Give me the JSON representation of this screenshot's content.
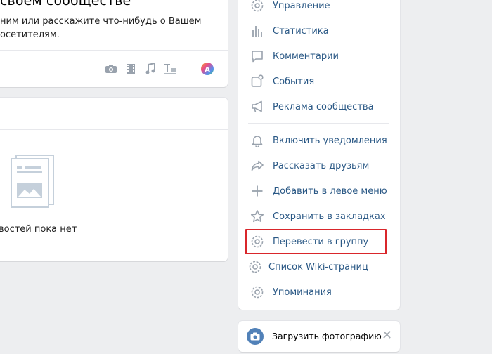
{
  "post_card": {
    "title": "своем сообществе",
    "description_line1": "ним или расскажите что-нибудь о Вашем",
    "description_line2": "осетителям.",
    "attach_icons": [
      "camera-icon",
      "video-icon",
      "music-icon",
      "text-format-icon",
      "color-palette-icon"
    ]
  },
  "news_card": {
    "empty_text": "овостей пока нет"
  },
  "menu": {
    "items": [
      {
        "label": "Управление",
        "icon": "gear-icon"
      },
      {
        "label": "Статистика",
        "icon": "stats-bars-icon"
      },
      {
        "label": "Комментарии",
        "icon": "comment-icon"
      },
      {
        "label": "События",
        "icon": "event-icon"
      },
      {
        "label": "Реклама сообщества",
        "icon": "megaphone-icon"
      },
      {
        "label": "Включить уведомления",
        "icon": "bell-icon"
      },
      {
        "label": "Рассказать друзьям",
        "icon": "share-arrow-icon"
      },
      {
        "label": "Добавить в левое меню",
        "icon": "plus-icon"
      },
      {
        "label": "Сохранить в закладках",
        "icon": "star-icon"
      },
      {
        "label": "Перевести в группу",
        "icon": "gear-icon"
      },
      {
        "label": "Список Wiki-страниц",
        "icon": "gear-icon"
      },
      {
        "label": "Упоминания",
        "icon": "gear-icon"
      }
    ],
    "highlighted_item": "Перевести в группу"
  },
  "upload": {
    "label": "Загрузить фотографию",
    "close": "✕"
  },
  "colors": {
    "link": "#2a5885",
    "icon": "#99a2ad",
    "highlight": "#d9262b",
    "accent": "#5181b8"
  }
}
